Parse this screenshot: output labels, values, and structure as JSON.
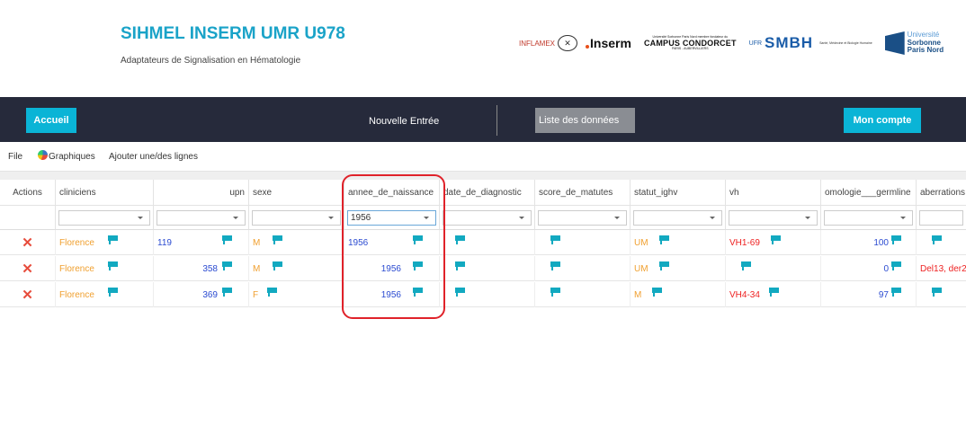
{
  "header": {
    "title": "SIHMEL INSERM UMR U978",
    "subtitle": "Adaptateurs de Signalisation en Hématologie",
    "logos": {
      "inflamex": "INFLAMEX",
      "inserm": "Inserm",
      "campus_small": "Université Sorbonne Paris Nord membre fondateur du",
      "campus_name": "CAMPUS CONDORCET",
      "campus_sub": "PARIS - AUBERVILLIERS",
      "ufr": "UFR",
      "smbh": "SMBH",
      "smbh_desc": "Santé, Médecine et Biologie Humaine",
      "usorb_line1": "Université",
      "usorb_line2": "Sorbonne",
      "usorb_line3": "Paris Nord"
    }
  },
  "nav": {
    "home": "Accueil",
    "new_entry": "Nouvelle Entrée",
    "data_list": "Liste des données",
    "account": "Mon compte"
  },
  "menu": {
    "file": "File",
    "charts": "Graphiques",
    "add_lines": "Ajouter une/des lignes"
  },
  "table": {
    "headers": [
      "Actions",
      "cliniciens",
      "upn",
      "sexe",
      "annee_de_naissance",
      "date_de_diagnostic",
      "score_de_matutes",
      "statut_ighv",
      "vh",
      "omologie___germline",
      "aberrations"
    ],
    "filter_year": "1956",
    "rows": [
      {
        "clinician": "Florence",
        "upn": "119",
        "sexe": "M",
        "annee": "1956",
        "statut": "UM",
        "vh": "VH1-69",
        "homologie": "100",
        "aberrations": ""
      },
      {
        "clinician": "Florence",
        "upn": "358",
        "sexe": "M",
        "annee": "1956",
        "statut": "UM",
        "vh": "",
        "homologie": "0",
        "aberrations": "Del13, der2"
      },
      {
        "clinician": "Florence",
        "upn": "369",
        "sexe": "F",
        "annee": "1956",
        "statut": "M",
        "vh": "VH4-34",
        "homologie": "97",
        "aberrations": ""
      }
    ],
    "delete_symbol": "✕"
  },
  "colors": {
    "accent": "#0ab4d6",
    "navbar": "#262a3b",
    "title": "#1aa3c8",
    "highlight_circle": "#e0222a"
  }
}
